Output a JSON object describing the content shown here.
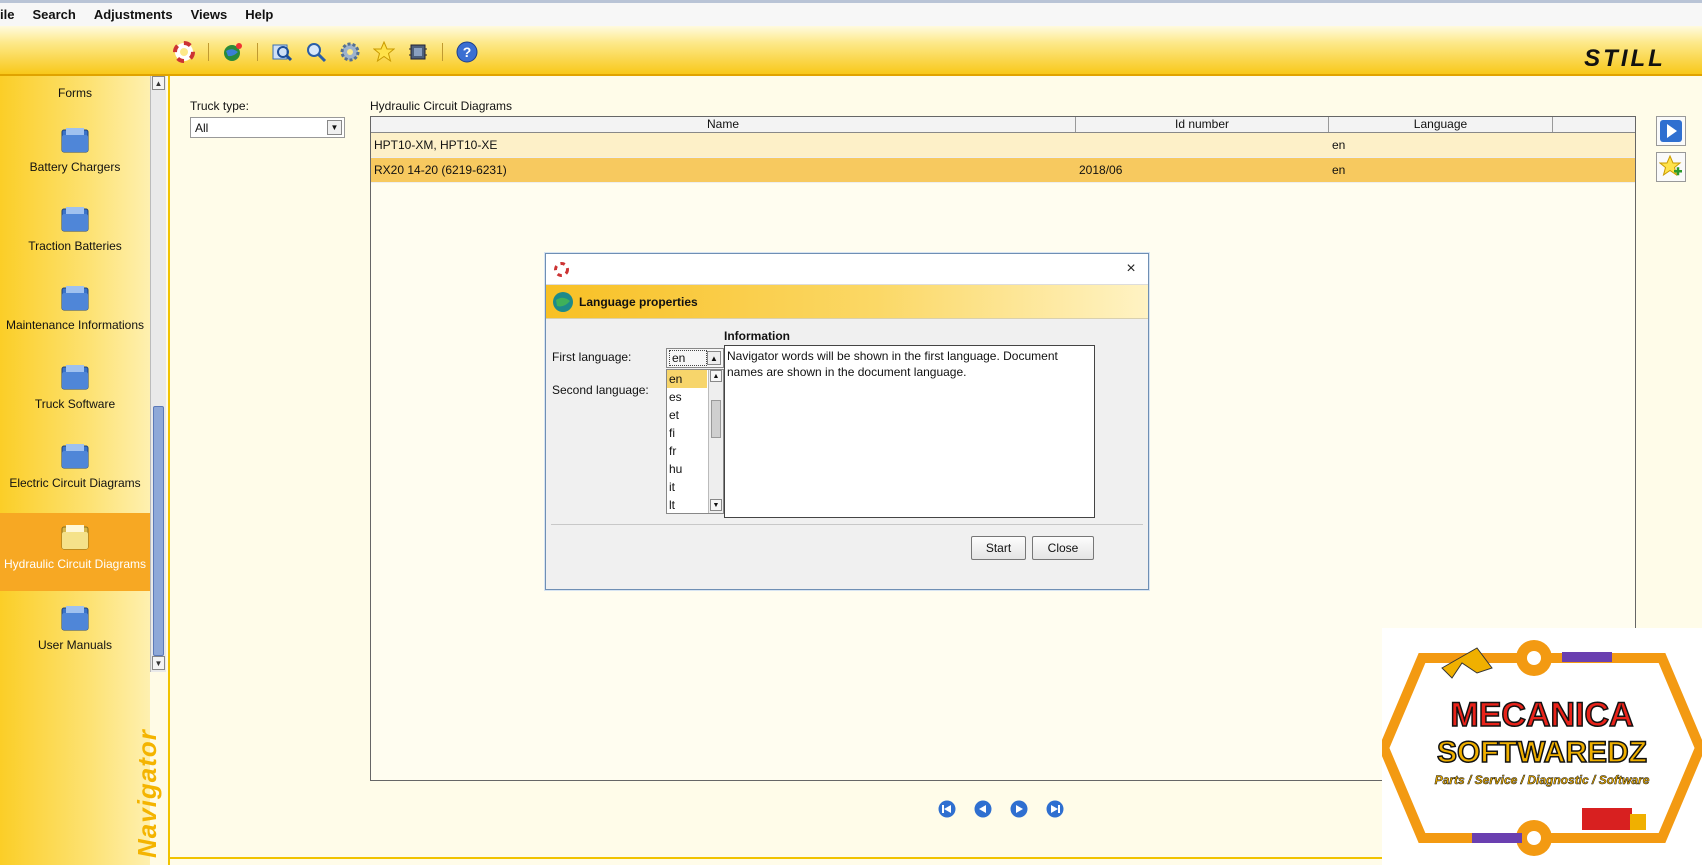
{
  "menu": [
    "ile",
    "Search",
    "Adjustments",
    "Views",
    "Help"
  ],
  "toolbar_icons": [
    "lifebuoy-icon",
    "globe-icon",
    "search-icon",
    "search-doc-icon",
    "gear-icon",
    "star-icon",
    "chip-icon",
    "help-icon"
  ],
  "brand_logo": "STILL",
  "navigator": {
    "items": [
      {
        "label": "Forms"
      },
      {
        "label": "Battery Chargers"
      },
      {
        "label": "Traction Batteries"
      },
      {
        "label": "Maintenance Informations"
      },
      {
        "label": "Truck Software"
      },
      {
        "label": "Electric Circuit Diagrams"
      },
      {
        "label": "Hydraulic Circuit Diagrams"
      },
      {
        "label": "User Manuals"
      }
    ],
    "active_index": 6,
    "vertical_title": "Navigator"
  },
  "filters": {
    "truck_type_label": "Truck type:",
    "truck_type_value": "All"
  },
  "table": {
    "title": "Hydraulic Circuit Diagrams",
    "columns": [
      "Name",
      "Id number",
      "Language"
    ],
    "rows": [
      {
        "name": "HPT10-XM, HPT10-XE",
        "id": "",
        "lang": "en"
      },
      {
        "name": "RX20 14-20 (6219-6231)",
        "id": "2018/06",
        "lang": "en"
      }
    ],
    "selected_row": 1
  },
  "dialog": {
    "title": "Language properties",
    "close_glyph": "×",
    "first_language_label": "First language:",
    "second_language_label": "Second language:",
    "first_language_value": "en",
    "language_options": [
      "en",
      "es",
      "et",
      "fi",
      "fr",
      "hu",
      "it",
      "lt"
    ],
    "info_label": "Information",
    "info_text": "Navigator words will be shown in the first language. Document names are shown in the document language.",
    "start_label": "Start",
    "close_label": "Close"
  },
  "watermark": {
    "line1": "MECANICA",
    "line2": "SOFTWAREDZ",
    "tagline": "Parts / Service / Diagnostic / Software"
  },
  "colors": {
    "accent_yellow": "#f8c81a",
    "active_orange": "#f7a823",
    "selected_row": "#f7c95f",
    "nav_blue": "#2f6fd0"
  }
}
